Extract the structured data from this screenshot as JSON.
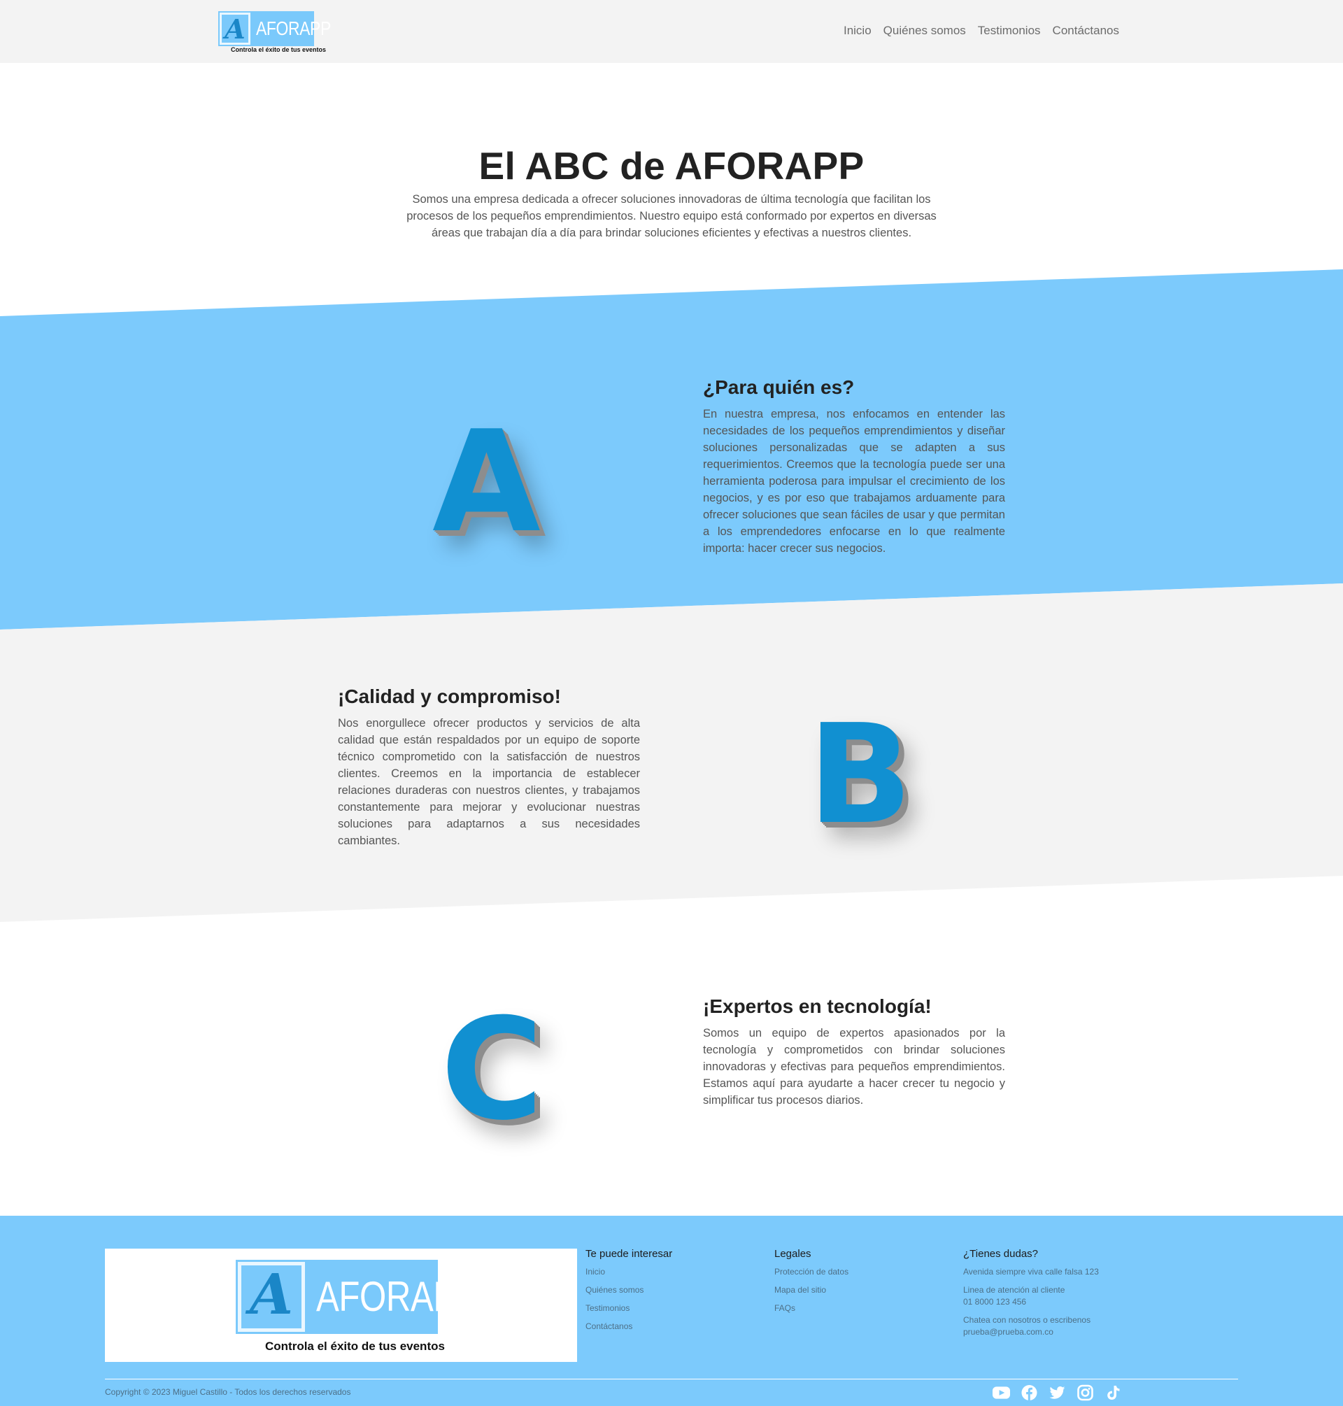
{
  "brand": {
    "name": "AFORAPP",
    "mark": "A",
    "tagline": "Controla el éxito de tus eventos"
  },
  "nav": {
    "links": [
      "Inicio",
      "Quiénes somos",
      "Testimonios",
      "Contáctanos"
    ]
  },
  "intro": {
    "title": "El ABC de AFORAPP",
    "text": "Somos una empresa dedicada a ofrecer soluciones innovadoras de última tecnología que facilitan los procesos de los pequeños emprendimientos. Nuestro equipo está conformado por expertos en diversas áreas que trabajan día a día para brindar soluciones eficientes y efectivas a nuestros clientes."
  },
  "sections": [
    {
      "letter": "A",
      "title": "¿Para quién es?",
      "body": "En nuestra empresa, nos enfocamos en entender las necesidades de los pequeños emprendimientos y diseñar soluciones personalizadas que se adapten a sus requerimientos. Creemos que la tecnología puede ser una herramienta poderosa para impulsar el crecimiento de los negocios, y es por eso que trabajamos arduamente para ofrecer soluciones que sean fáciles de usar y que permitan a los emprendedores enfocarse en lo que realmente importa: hacer crecer sus negocios."
    },
    {
      "letter": "B",
      "title": "¡Calidad y compromiso!",
      "body": "Nos enorgullece ofrecer productos y servicios de alta calidad que están respaldados por un equipo de soporte técnico comprometido con la satisfacción de nuestros clientes. Creemos en la importancia de establecer relaciones duraderas con nuestros clientes, y trabajamos constantemente para mejorar y evolucionar nuestras soluciones para adaptarnos a sus necesidades cambiantes."
    },
    {
      "letter": "C",
      "title": "¡Expertos en tecnología!",
      "body": "Somos un equipo de expertos apasionados por la tecnología y comprometidos con brindar soluciones innovadoras y efectivas para pequeños emprendimientos. Estamos aquí para ayudarte a hacer crecer tu negocio y simplificar tus procesos diarios."
    }
  ],
  "footer": {
    "col1": {
      "title": "Te puede interesar",
      "links": [
        "Inicio",
        "Quiénes somos",
        "Testimonios",
        "Contáctanos"
      ]
    },
    "col2": {
      "title": "Legales",
      "links": [
        "Protección de datos",
        "Mapa del sitio",
        "FAQs"
      ]
    },
    "col3": {
      "title": "¿Tienes dudas?",
      "address": "Avenida siempre viva calle falsa 123",
      "phone_label": "Linea de atención al cliente",
      "phone": "01 8000 123 456",
      "chat_label": "Chatea con nosotros o escribenos",
      "email": "prueba@prueba.com.co"
    },
    "copyright": "Copyright © 2023 Miguel Castillo - Todos los derechos reservados",
    "socials": [
      "youtube-icon",
      "facebook-icon",
      "twitter-icon",
      "instagram-icon",
      "tiktok-icon"
    ]
  },
  "colors": {
    "accent_blue": "#7ccafc",
    "letter_blue": "#1190d1",
    "light_gray": "#f3f3f3"
  }
}
